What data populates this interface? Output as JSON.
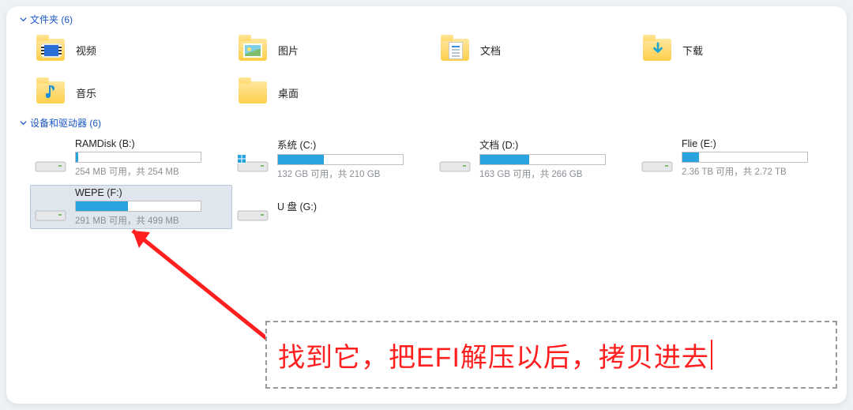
{
  "sections": {
    "folders_header": "文件夹 (6)",
    "drives_header": "设备和驱动器 (6)"
  },
  "folders": [
    {
      "id": "video",
      "label": "视频"
    },
    {
      "id": "pictures",
      "label": "图片"
    },
    {
      "id": "docs",
      "label": "文档"
    },
    {
      "id": "downloads",
      "label": "下载"
    },
    {
      "id": "music",
      "label": "音乐"
    },
    {
      "id": "desktop",
      "label": "桌面"
    }
  ],
  "drives": [
    {
      "id": "ramdisk",
      "name": "RAMDisk (B:)",
      "stats": "254 MB 可用，共 254 MB",
      "fill_pct": 2,
      "os_badge": false,
      "has_bar": true
    },
    {
      "id": "system",
      "name": "系统 (C:)",
      "stats": "132 GB 可用，共 210 GB",
      "fill_pct": 37,
      "os_badge": true,
      "has_bar": true
    },
    {
      "id": "docsd",
      "name": "文档 (D:)",
      "stats": "163 GB 可用，共 266 GB",
      "fill_pct": 39,
      "os_badge": false,
      "has_bar": true
    },
    {
      "id": "flie",
      "name": "Flie (E:)",
      "stats": "2.36 TB 可用，共 2.72 TB",
      "fill_pct": 13,
      "os_badge": false,
      "has_bar": true
    },
    {
      "id": "wepe",
      "name": "WEPE (F:)",
      "stats": "291 MB 可用，共 499 MB",
      "fill_pct": 42,
      "os_badge": false,
      "has_bar": true,
      "selected": true
    },
    {
      "id": "udisk",
      "name": "U 盘 (G:)",
      "stats": "",
      "fill_pct": 0,
      "os_badge": false,
      "has_bar": false
    }
  ],
  "annotation": {
    "text": "找到它，把EFI解压以后，拷贝进去"
  }
}
